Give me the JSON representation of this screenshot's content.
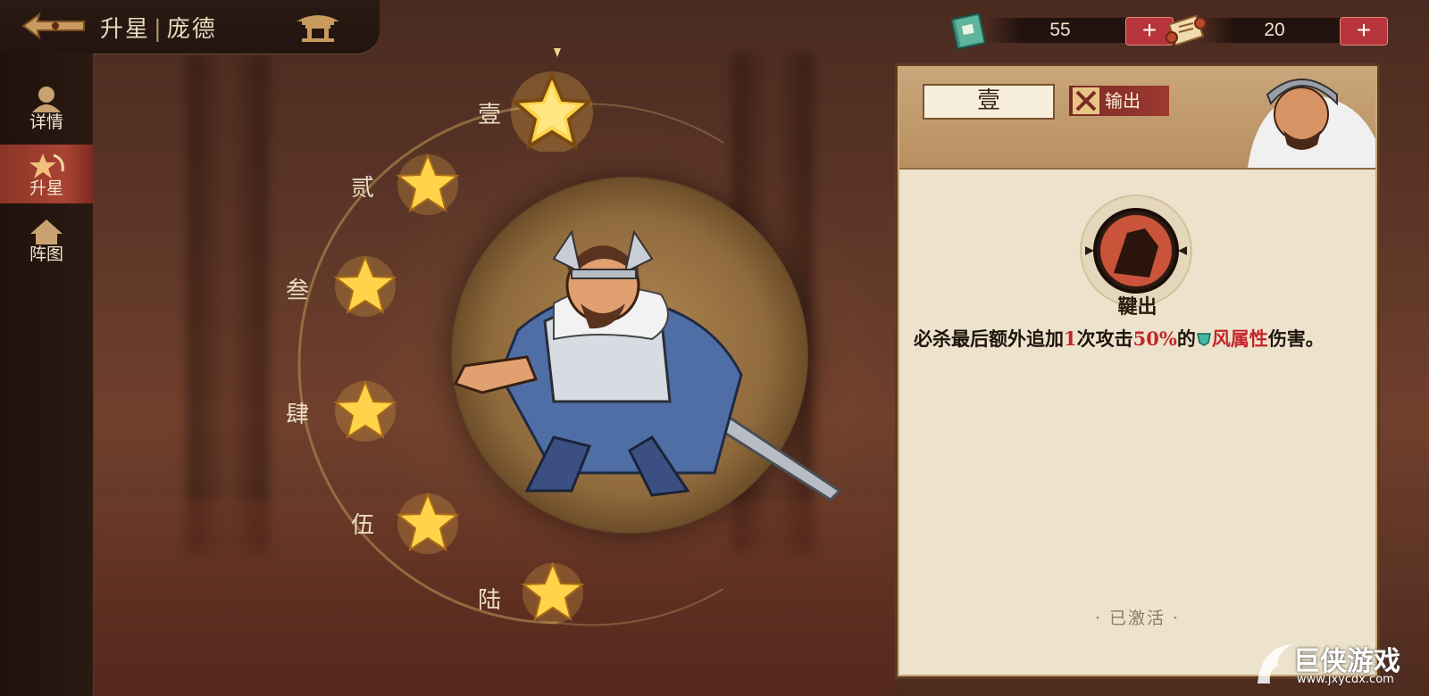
{
  "header": {
    "title_left": "升星",
    "title_sep": "|",
    "title_right": "庞德"
  },
  "currencies": [
    {
      "icon": "book-icon",
      "value": "55",
      "plus": "+"
    },
    {
      "icon": "scroll-icon",
      "value": "20",
      "plus": "+"
    }
  ],
  "sidebar": {
    "items": [
      {
        "label": "详情",
        "icon": "profile-icon",
        "active": false
      },
      {
        "label": "升星",
        "icon": "star-upgrade-icon",
        "active": true
      },
      {
        "label": "阵图",
        "icon": "formation-icon",
        "active": false
      }
    ]
  },
  "stars": {
    "labels": [
      "壹",
      "贰",
      "叁",
      "肆",
      "伍",
      "陆"
    ],
    "selected_index": 0
  },
  "panel": {
    "rank": "壹",
    "role": "输出",
    "skill_icon": "skill-icon",
    "skill_name": "鞬出",
    "desc_part1": "必杀最后额外追加",
    "desc_num1": "1",
    "desc_part2": "次攻击",
    "desc_num2": "50%",
    "desc_part3": "的",
    "desc_attr": "风属性",
    "desc_part4": "伤害。",
    "status": "· 已激活 ·"
  },
  "watermark": {
    "title": "巨侠游戏",
    "url": "www.jxycdx.com"
  },
  "colors": {
    "accent_red": "#c3262a",
    "plus_button": "#b6343a",
    "active_tab": "#a94434",
    "star_gold": "#ffd34a",
    "panel_bg": "#ede3cc"
  }
}
